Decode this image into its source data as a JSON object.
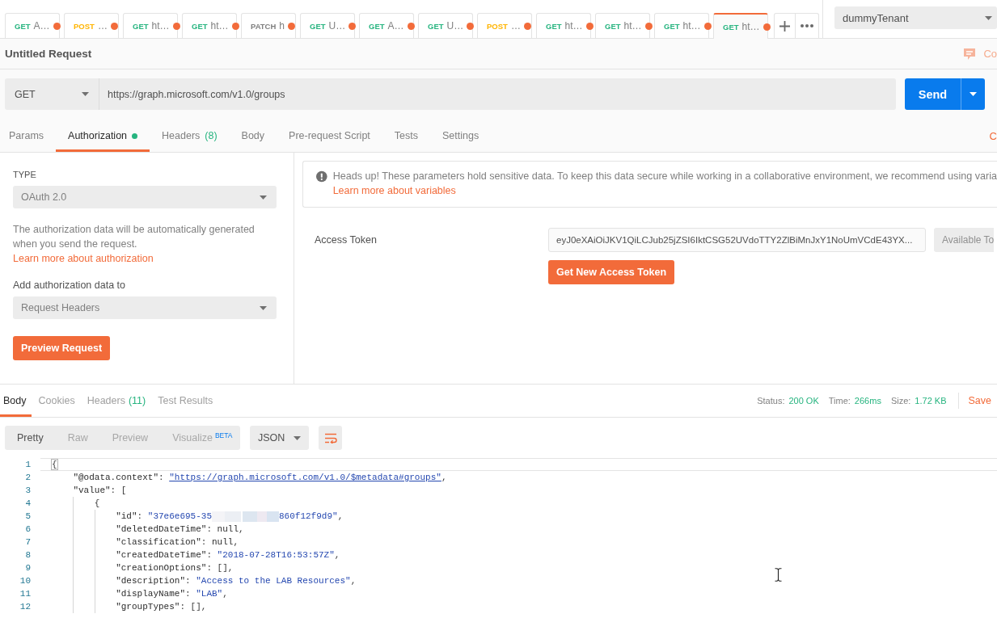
{
  "open_tabs": [
    {
      "method": "GET",
      "color": "#26b47f",
      "label": "A…",
      "unsaved": true,
      "selected": false
    },
    {
      "method": "POST",
      "color": "#ffb400",
      "label": "…",
      "unsaved": true,
      "selected": false
    },
    {
      "method": "GET",
      "color": "#26b47f",
      "label": "ht…",
      "unsaved": true,
      "selected": false
    },
    {
      "method": "GET",
      "color": "#26b47f",
      "label": "ht…",
      "unsaved": true,
      "selected": false
    },
    {
      "method": "PATCH",
      "color": "#808080",
      "label": "h",
      "unsaved": true,
      "selected": false
    },
    {
      "method": "GET",
      "color": "#26b47f",
      "label": "U…",
      "unsaved": true,
      "selected": false
    },
    {
      "method": "GET",
      "color": "#26b47f",
      "label": "A…",
      "unsaved": true,
      "selected": false
    },
    {
      "method": "GET",
      "color": "#26b47f",
      "label": "U…",
      "unsaved": true,
      "selected": false
    },
    {
      "method": "POST",
      "color": "#ffb400",
      "label": "…",
      "unsaved": true,
      "selected": false
    },
    {
      "method": "GET",
      "color": "#26b47f",
      "label": "ht…",
      "unsaved": true,
      "selected": false
    },
    {
      "method": "GET",
      "color": "#26b47f",
      "label": "ht…",
      "unsaved": true,
      "selected": false
    },
    {
      "method": "GET",
      "color": "#26b47f",
      "label": "ht…",
      "unsaved": true,
      "selected": false
    },
    {
      "method": "GET",
      "color": "#26b47f",
      "label": "ht…",
      "unsaved": true,
      "selected": true
    }
  ],
  "environment": {
    "value": "dummyTenant"
  },
  "request": {
    "title": "Untitled Request",
    "comments_label": "Co",
    "method": "GET",
    "url": "https://graph.microsoft.com/v1.0/groups",
    "send_label": "Send"
  },
  "request_sections": {
    "tabs": [
      {
        "label": "Params",
        "selected": false,
        "indicator": false
      },
      {
        "label": "Authorization",
        "selected": true,
        "indicator": true
      },
      {
        "label": "Headers",
        "count": "(8)",
        "selected": false,
        "indicator": false
      },
      {
        "label": "Body",
        "selected": false,
        "indicator": false
      },
      {
        "label": "Pre-request Script",
        "selected": false,
        "indicator": false
      },
      {
        "label": "Tests",
        "selected": false,
        "indicator": false
      },
      {
        "label": "Settings",
        "selected": false,
        "indicator": false
      }
    ],
    "cookies_label": "C"
  },
  "authorization": {
    "type_label": "TYPE",
    "type_value": "OAuth 2.0",
    "description": "The authorization data will be automatically generated when you send the request.",
    "description_link": "Learn more about authorization",
    "add_to_label": "Add authorization data to",
    "add_to_value": "Request Headers",
    "preview_button": "Preview Request",
    "notice": {
      "text": "Heads up! These parameters hold sensitive data. To keep this data secure while working in a collaborative environment, we recommend using varia",
      "link": "Learn more about variables"
    },
    "access_token": {
      "label": "Access Token",
      "value": "eyJ0eXAiOiJKV1QiLCJub25jZSI6IktCSG52UVdoTTY2ZlBiMnJxY1NoUmVCdE43YX...",
      "available_label": "Available To",
      "get_new_button": "Get New Access Token"
    }
  },
  "response": {
    "tabs": [
      {
        "label": "Body",
        "selected": true
      },
      {
        "label": "Cookies",
        "selected": false
      },
      {
        "label": "Headers",
        "count": "(11)",
        "selected": false
      },
      {
        "label": "Test Results",
        "selected": false
      }
    ],
    "stats": [
      {
        "label": "Status:",
        "value": "200 OK"
      },
      {
        "label": "Time:",
        "value": "266ms"
      },
      {
        "label": "Size:",
        "value": "1.72 KB"
      }
    ],
    "save_label": "Save",
    "view_modes": [
      {
        "label": "Pretty",
        "selected": true
      },
      {
        "label": "Raw",
        "selected": false
      },
      {
        "label": "Preview",
        "selected": false
      },
      {
        "label": "Visualize",
        "badge": "BETA",
        "selected": false
      }
    ],
    "format": "JSON",
    "code_lines": [
      {
        "number": "1",
        "active": true,
        "tokens": [
          {
            "kind": "punct",
            "text": "{"
          }
        ],
        "children": [
          {
            "number": "2",
            "active": false,
            "tokens": [
              {
                "kind": "key",
                "text": "\"@odata.context\""
              },
              {
                "kind": "punct",
                "text": ": "
              },
              {
                "kind": "link",
                "text": "\"https://graph.microsoft.com/v1.0/$metadata#groups\""
              },
              {
                "kind": "punct",
                "text": ","
              }
            ]
          },
          {
            "number": "3",
            "active": false,
            "tokens": [
              {
                "kind": "key",
                "text": "\"value\""
              },
              {
                "kind": "punct",
                "text": ": ["
              }
            ],
            "children": [
              {
                "number": "4",
                "active": false,
                "tokens": [
                  {
                    "kind": "punct",
                    "text": "{"
                  }
                ],
                "children": [
                  {
                    "number": "5",
                    "active": false,
                    "tokens": [
                      {
                        "kind": "key",
                        "text": "\"id\""
                      },
                      {
                        "kind": "punct",
                        "text": ": "
                      },
                      {
                        "kind": "string",
                        "text": "\"37e6e695-35"
                      },
                      {
                        "kind": "redacted"
                      },
                      {
                        "kind": "string",
                        "text": "860f12f9d9\""
                      },
                      {
                        "kind": "punct",
                        "text": ","
                      }
                    ]
                  },
                  {
                    "number": "6",
                    "active": false,
                    "tokens": [
                      {
                        "kind": "key",
                        "text": "\"deletedDateTime\""
                      },
                      {
                        "kind": "punct",
                        "text": ": "
                      },
                      {
                        "kind": "literal",
                        "text": "null"
                      },
                      {
                        "kind": "punct",
                        "text": ","
                      }
                    ]
                  },
                  {
                    "number": "7",
                    "active": false,
                    "tokens": [
                      {
                        "kind": "key",
                        "text": "\"classification\""
                      },
                      {
                        "kind": "punct",
                        "text": ": "
                      },
                      {
                        "kind": "literal",
                        "text": "null"
                      },
                      {
                        "kind": "punct",
                        "text": ","
                      }
                    ]
                  },
                  {
                    "number": "8",
                    "active": false,
                    "tokens": [
                      {
                        "kind": "key",
                        "text": "\"createdDateTime\""
                      },
                      {
                        "kind": "punct",
                        "text": ": "
                      },
                      {
                        "kind": "string",
                        "text": "\"2018-07-28T16:53:57Z\""
                      },
                      {
                        "kind": "punct",
                        "text": ","
                      }
                    ]
                  },
                  {
                    "number": "9",
                    "active": false,
                    "tokens": [
                      {
                        "kind": "key",
                        "text": "\"creationOptions\""
                      },
                      {
                        "kind": "punct",
                        "text": ": [],"
                      }
                    ]
                  },
                  {
                    "number": "10",
                    "active": false,
                    "tokens": [
                      {
                        "kind": "key",
                        "text": "\"description\""
                      },
                      {
                        "kind": "punct",
                        "text": ": "
                      },
                      {
                        "kind": "string",
                        "text": "\"Access to the LAB Resources\""
                      },
                      {
                        "kind": "punct",
                        "text": ","
                      }
                    ]
                  },
                  {
                    "number": "11",
                    "active": false,
                    "tokens": [
                      {
                        "kind": "key",
                        "text": "\"displayName\""
                      },
                      {
                        "kind": "punct",
                        "text": ": "
                      },
                      {
                        "kind": "string",
                        "text": "\"LAB\""
                      },
                      {
                        "kind": "punct",
                        "text": ","
                      }
                    ]
                  },
                  {
                    "number": "12",
                    "active": false,
                    "tokens": [
                      {
                        "kind": "key",
                        "text": "\"groupTypes\""
                      },
                      {
                        "kind": "punct",
                        "text": ": [],"
                      }
                    ]
                  }
                ]
              }
            ]
          }
        ]
      }
    ]
  }
}
